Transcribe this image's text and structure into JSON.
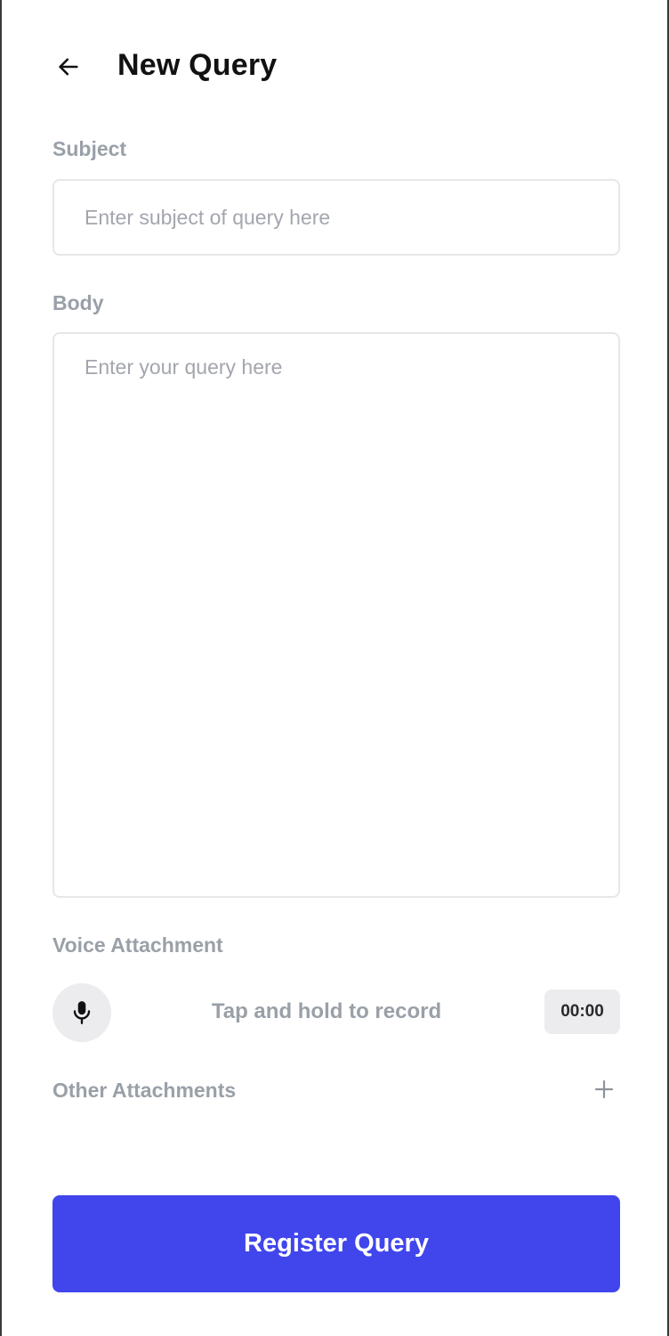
{
  "header": {
    "title": "New Query",
    "back_icon": "arrow-left-icon"
  },
  "subject": {
    "label": "Subject",
    "value": "",
    "placeholder": "Enter subject of query here"
  },
  "body": {
    "label": "Body",
    "value": "",
    "placeholder": "Enter your query here"
  },
  "voice": {
    "label": "Voice Attachment",
    "mic_icon": "microphone-icon",
    "hint": "Tap and hold to record",
    "timer": "00:00"
  },
  "other": {
    "label": "Other Attachments",
    "add_icon": "plus-icon"
  },
  "submit": {
    "label": "Register Query"
  },
  "colors": {
    "accent": "#4045ec",
    "label": "#9aa0a8",
    "placeholder": "#a3a6ad",
    "chip_bg": "#ececef"
  }
}
